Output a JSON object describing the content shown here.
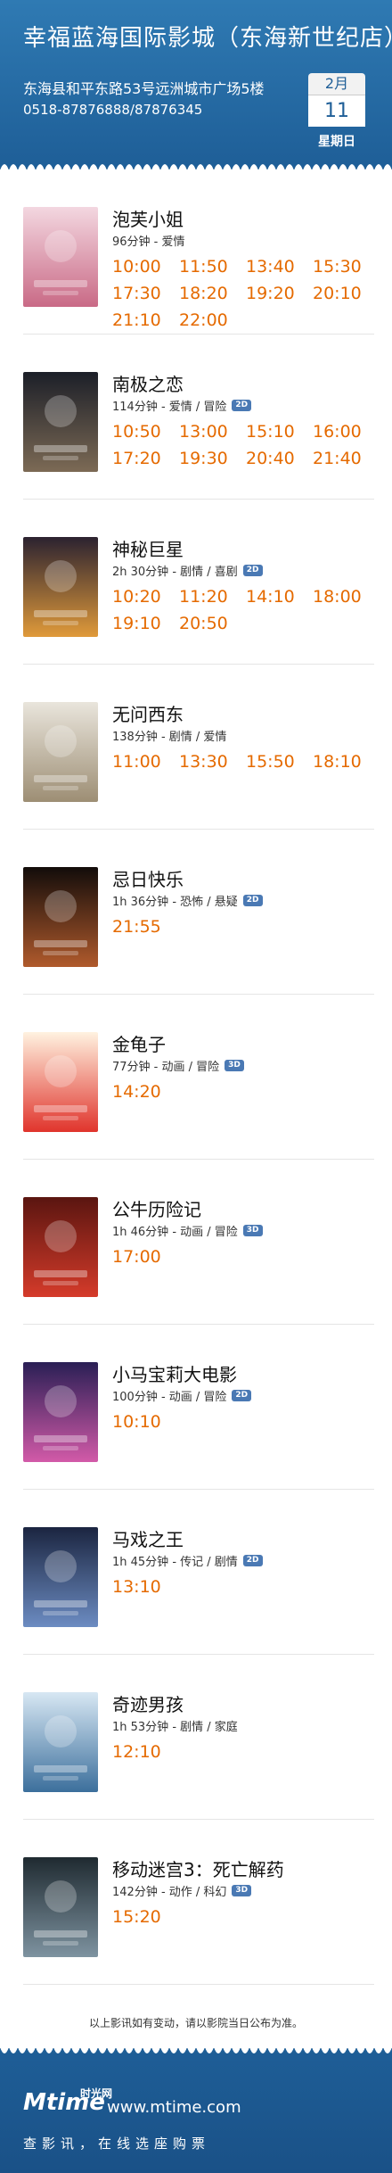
{
  "cinema": {
    "name": "幸福蓝海国际影城（东海新世纪店）",
    "address": "东海县和平东路53号远洲城市广场5楼",
    "phone": "0518-87876888/87876345"
  },
  "date": {
    "month": "2月",
    "day": "11",
    "weekday": "星期日"
  },
  "movies": [
    {
      "title": "泡芙小姐",
      "meta": "96分钟 - 爱情",
      "badge": "",
      "times": [
        "10:00",
        "11:50",
        "13:40",
        "15:30",
        "17:30",
        "18:20",
        "19:20",
        "20:10",
        "21:10",
        "22:00"
      ]
    },
    {
      "title": "南极之恋",
      "meta": "114分钟 - 爱情 / 冒险",
      "badge": "2D",
      "times": [
        "10:50",
        "13:00",
        "15:10",
        "16:00",
        "17:20",
        "19:30",
        "20:40",
        "21:40"
      ]
    },
    {
      "title": "神秘巨星",
      "meta": "2h 30分钟 - 剧情 / 喜剧",
      "badge": "2D",
      "times": [
        "10:20",
        "11:20",
        "14:10",
        "18:00",
        "19:10",
        "20:50"
      ]
    },
    {
      "title": "无问西东",
      "meta": "138分钟 - 剧情 / 爱情",
      "badge": "",
      "times": [
        "11:00",
        "13:30",
        "15:50",
        "18:10"
      ]
    },
    {
      "title": "忌日快乐",
      "meta": "1h 36分钟 - 恐怖 / 悬疑",
      "badge": "2D",
      "times": [
        "21:55"
      ]
    },
    {
      "title": "金龟子",
      "meta": "77分钟 - 动画 / 冒险",
      "badge": "3D",
      "times": [
        "14:20"
      ]
    },
    {
      "title": "公牛历险记",
      "meta": "1h 46分钟 - 动画 / 冒险",
      "badge": "3D",
      "times": [
        "17:00"
      ]
    },
    {
      "title": "小马宝莉大电影",
      "meta": "100分钟 - 动画 / 冒险",
      "badge": "2D",
      "times": [
        "10:10"
      ]
    },
    {
      "title": "马戏之王",
      "meta": "1h 45分钟 - 传记 / 剧情",
      "badge": "2D",
      "times": [
        "13:10"
      ]
    },
    {
      "title": "奇迹男孩",
      "meta": "1h 53分钟 - 剧情 / 家庭",
      "badge": "",
      "times": [
        "12:10"
      ]
    },
    {
      "title": "移动迷宫3：死亡解药",
      "meta": "142分钟 - 动作 / 科幻",
      "badge": "3D",
      "times": [
        "15:20"
      ]
    }
  ],
  "note": "以上影讯如有变动，请以影院当日公布为准。",
  "footer": {
    "logo": "Mtime",
    "logo_cn": "时光网",
    "site": "www.mtime.com",
    "slogan": "查影讯，在线选座购票"
  },
  "colors": {
    "header_blue": "#1e5e97",
    "time_orange": "#e56a00"
  }
}
